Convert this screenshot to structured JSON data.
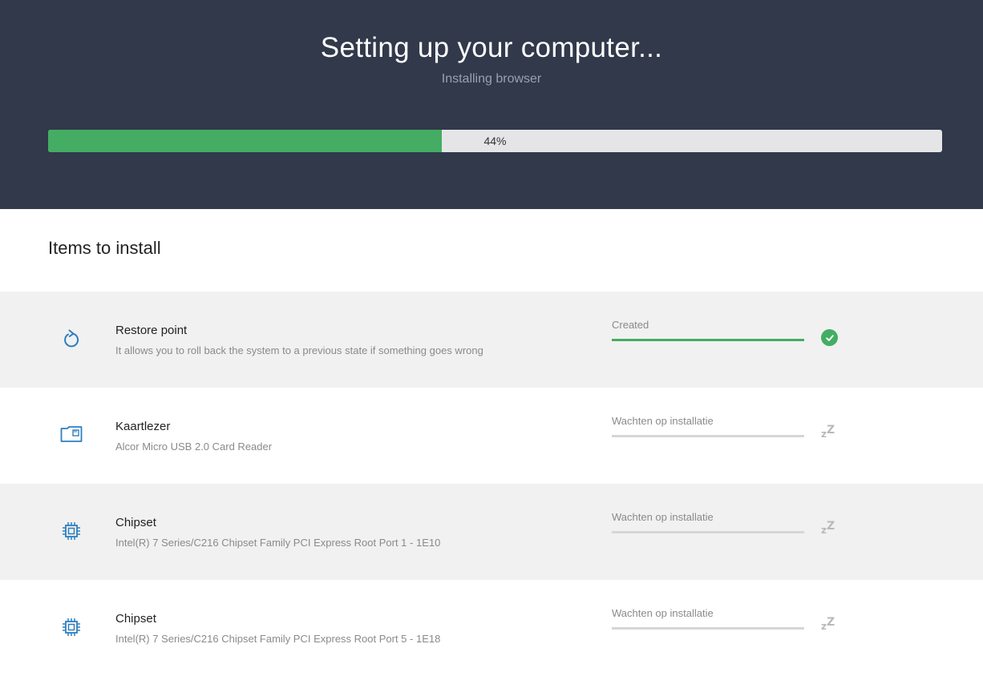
{
  "header": {
    "title": "Setting up your computer...",
    "subtitle": "Installing browser",
    "progress_percent": 44,
    "progress_label": "44%"
  },
  "section": {
    "title": "Items to install"
  },
  "colors": {
    "header_bg": "#31394b",
    "accent_green": "#44ad63",
    "icon_blue": "#2d7fc0",
    "row_shaded_bg": "#f1f1f1"
  },
  "items": [
    {
      "icon": "restore-icon",
      "title": "Restore point",
      "description": "It allows you to roll back the system to a previous state if something goes wrong",
      "status": "Created",
      "progress": 1.0,
      "state_icon": "check-circle-icon"
    },
    {
      "icon": "card-reader-icon",
      "title": "Kaartlezer",
      "description": "Alcor Micro USB 2.0 Card Reader",
      "status": "Wachten op installatie",
      "progress": 0.0,
      "state_icon": "sleep-zz-icon"
    },
    {
      "icon": "chip-icon",
      "title": "Chipset",
      "description": "Intel(R) 7 Series/C216 Chipset Family PCI Express Root Port 1 - 1E10",
      "status": "Wachten op installatie",
      "progress": 0.0,
      "state_icon": "sleep-zz-icon"
    },
    {
      "icon": "chip-icon",
      "title": "Chipset",
      "description": "Intel(R) 7 Series/C216 Chipset Family PCI Express Root Port 5 - 1E18",
      "status": "Wachten op installatie",
      "progress": 0.0,
      "state_icon": "sleep-zz-icon"
    }
  ]
}
